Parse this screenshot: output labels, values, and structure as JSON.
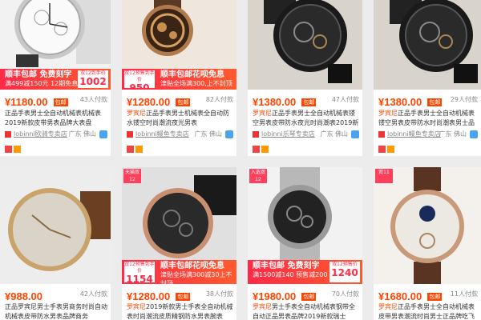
{
  "products": [
    {
      "image": "watch-silver-chrono",
      "badge": "",
      "promo": {
        "line1": "顺丰包邮 免费刻字",
        "line2": "满499减150元 12期免息",
        "box_label": "双12到手价",
        "box_price": "1002"
      },
      "price": "¥1180.00",
      "baoyou": "包邮",
      "sales": "43人付款",
      "title_hl": "",
      "title": "正品手表男士全自动机械表机械表2019新款皮带男表品牌大表盘",
      "shop": "lobinni欧骑专卖店",
      "location": "广东 佛山"
    },
    {
      "image": "watch-gold-skeleton",
      "badge": "",
      "promo": {
        "line1": "顺丰包邮花呗免息",
        "line2": "津贴全场满300,上不封顶",
        "box_label": "双12预售到手价",
        "box_price": "950"
      },
      "price": "¥1280.00",
      "baoyou": "包邮",
      "sales": "82人付款",
      "title_hl": "罗宾尼",
      "title": "正品手表男士机械表全自动防水镂空时尚潮流夜光男表",
      "shop": "lobinni鳗鱼专卖店",
      "location": "广东 佛山"
    },
    {
      "image": "watch-black-skeleton",
      "badge": "",
      "promo": null,
      "price": "¥1380.00",
      "baoyou": "包邮",
      "sales": "47人付款",
      "title_hl": "罗宾尼",
      "title": "正品手表男士全自动机械表镂空男表皮带防水夜光时尚潮表2019新款",
      "shop": "lobinni乐琴专卖店",
      "location": "广东 佛山"
    },
    {
      "image": "watch-black-skeleton-2",
      "badge": "",
      "promo": null,
      "price": "¥1380.00",
      "baoyou": "包邮",
      "sales": "29人付款",
      "title_hl": "罗宾尼",
      "title": "正品手表男士全自动机械表镂空男表皮带防水时尚潮表男士品牌2019新款",
      "shop": "lobinni鳗鱼专卖店",
      "location": "广东 佛山"
    },
    {
      "image": "watch-gold-classic",
      "badge": "",
      "promo": null,
      "price": "¥988.00",
      "baoyou": "",
      "sales": "42人付款",
      "title_hl": "",
      "title": "正品罗宾尼男士手表男商务时尚自动机械表皮带防水男表品牌商务",
      "shop": "",
      "location": ""
    },
    {
      "image": "watch-rose-gold-black",
      "badge": "天猫双12",
      "promo": {
        "line1": "顺丰包邮花呗免息",
        "line2": "津贴全场满300减30上不封顶",
        "box_label": "双12预售到手价",
        "box_price": "1154"
      },
      "price": "¥1280.00",
      "baoyou": "包邮",
      "sales": "38人付款",
      "title_hl": "罗宾尼",
      "title": "2019新款男士手表全自动机械表时尚潮流皮质精钢防水男表腕表",
      "shop": "",
      "location": ""
    },
    {
      "image": "watch-steel-black",
      "badge": "入选双12",
      "promo": {
        "line1": "顺丰包邮 免费刻字",
        "line2": "满1500减140 预售减200",
        "box_label": "双12预售价",
        "box_price": "1240"
      },
      "price": "¥1980.00",
      "baoyou": "包邮",
      "sales": "70人付款",
      "title_hl": "罗宾尼",
      "title": "男士手表全自动机械表钢带全自动正品男表品牌2019新款瑞士",
      "shop": "",
      "location": ""
    },
    {
      "image": "watch-moonphase-rose",
      "badge": "双11",
      "promo": null,
      "price": "¥1680.00",
      "baoyou": "包邮",
      "sales": "11人付款",
      "title_hl": "罗宾尼",
      "title": "正品手表男士全自动机械表皮带男表潮流时尚男士正品牌吃飞轮",
      "shop": "",
      "location": ""
    }
  ]
}
